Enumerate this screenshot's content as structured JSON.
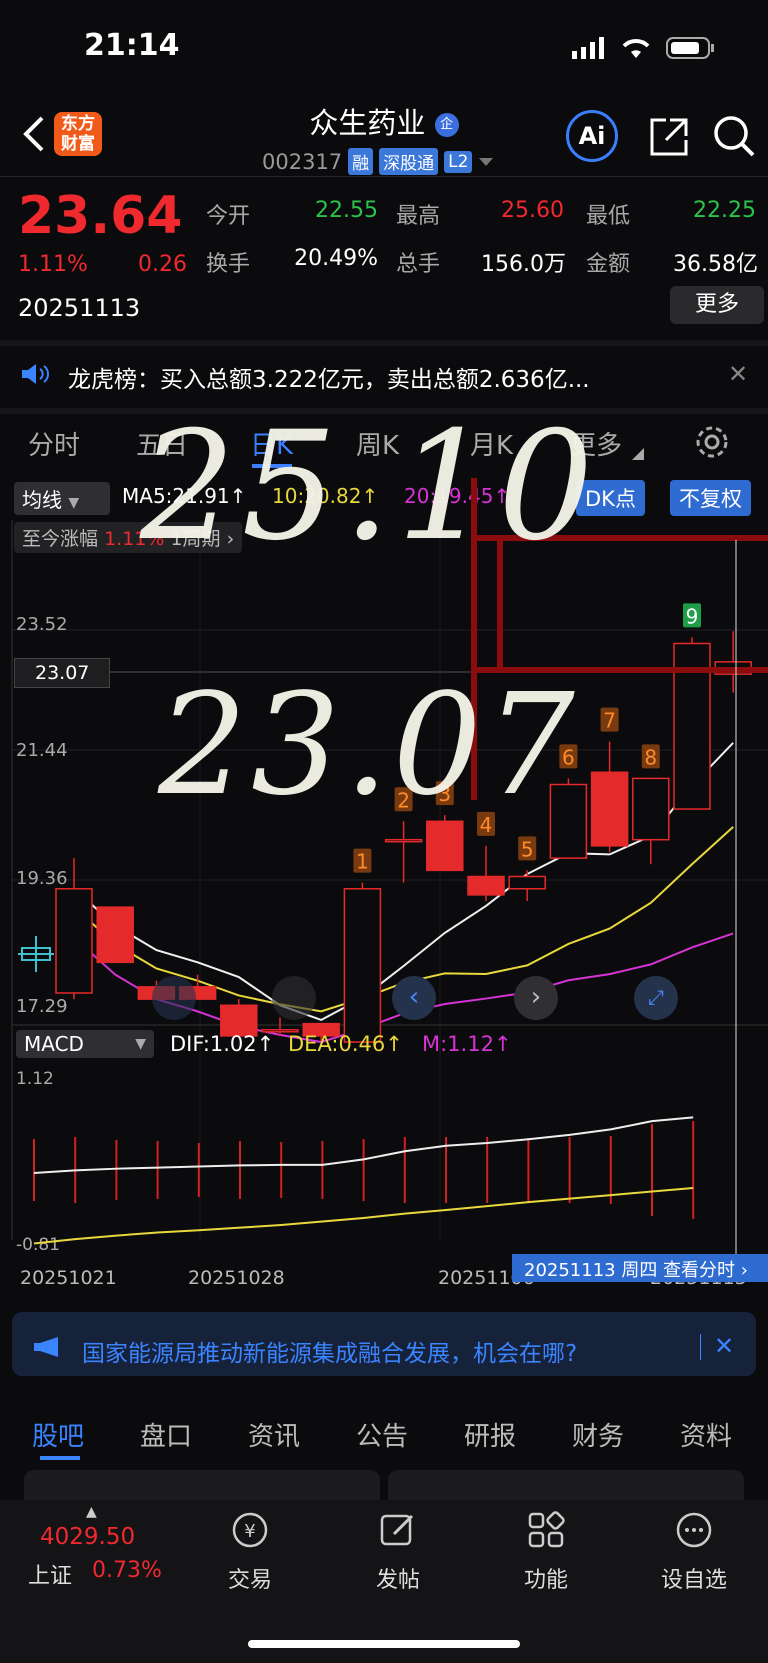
{
  "status": {
    "time": "21:14"
  },
  "header": {
    "logo_line1": "东方",
    "logo_line2": "财富",
    "stock_name": "众生药业",
    "stock_code": "002317",
    "tags": [
      "融",
      "深股通",
      "L2"
    ],
    "badge": "企",
    "ai_label": "Ai"
  },
  "quote": {
    "price": "23.64",
    "change_pct": "1.11%",
    "change": "0.26",
    "date": "20251113",
    "open_label": "今开",
    "open": "22.55",
    "high_label": "最高",
    "high": "25.60",
    "low_label": "最低",
    "low": "22.25",
    "turnover_label": "换手",
    "turnover": "20.49%",
    "volume_label": "总手",
    "volume": "156.0万",
    "amount_label": "金额",
    "amount": "36.58亿",
    "more_label": "更多"
  },
  "dragon_tiger": {
    "text": "龙虎榜：买入总额3.222亿元，卖出总额2.636亿..."
  },
  "chart_tabs": [
    "分时",
    "五日",
    "日K",
    "周K",
    "月K",
    "更多"
  ],
  "chart_controls": {
    "ma_select": "均线",
    "ma5": "MA5:21.91↑",
    "ma10": "10:20.82↑",
    "ma20": "20:19.45↑",
    "dk_button": "DK点",
    "adjust_button": "不复权",
    "range_label": "至今涨幅",
    "range_value": "1.11%",
    "range_period": "1周期",
    "macd_select": "MACD",
    "dif": "DIF:1.02↑",
    "dea": "DEA:0.46↑",
    "m": "M:1.12↑",
    "crosshair_label": "20251113 周四 查看分时"
  },
  "handwriting": {
    "line1": "25.10",
    "line2": "23.07"
  },
  "chart_data": {
    "type": "candlestick",
    "y_ticks": [
      "23.52",
      "21.44",
      "19.36",
      "17.29"
    ],
    "y_range": [
      17.29,
      23.52
    ],
    "ref_price": "23.07",
    "x_labels": [
      "20251021",
      "20251028",
      "20251106",
      "20251113"
    ],
    "candles": [
      {
        "o": 17.6,
        "c": 19.3,
        "h": 19.8,
        "l": 17.5
      },
      {
        "o": 19.0,
        "c": 18.1,
        "h": 19.0,
        "l": 18.1
      },
      {
        "o": 17.7,
        "c": 17.5,
        "h": 17.8,
        "l": 17.5
      },
      {
        "o": 17.7,
        "c": 17.5,
        "h": 17.9,
        "l": 17.5
      },
      {
        "o": 17.4,
        "c": 16.9,
        "h": 17.5,
        "l": 16.9
      },
      {
        "o": 17.0,
        "c": 17.0,
        "h": 17.2,
        "l": 16.9
      },
      {
        "o": 17.1,
        "c": 16.9,
        "h": 17.1,
        "l": 16.8
      },
      {
        "o": 16.8,
        "c": 19.3,
        "h": 19.4,
        "l": 16.8
      },
      {
        "o": 20.1,
        "c": 20.1,
        "h": 20.4,
        "l": 19.4
      },
      {
        "o": 20.4,
        "c": 19.6,
        "h": 20.5,
        "l": 19.6
      },
      {
        "o": 19.5,
        "c": 19.2,
        "h": 20.0,
        "l": 19.1
      },
      {
        "o": 19.3,
        "c": 19.5,
        "h": 19.6,
        "l": 19.1
      },
      {
        "o": 19.8,
        "c": 21.0,
        "h": 21.1,
        "l": 19.8
      },
      {
        "o": 21.2,
        "c": 20.0,
        "h": 21.7,
        "l": 19.9
      },
      {
        "o": 20.1,
        "c": 21.1,
        "h": 21.1,
        "l": 19.7
      },
      {
        "o": 20.6,
        "c": 23.3,
        "h": 23.4,
        "l": 20.6
      },
      {
        "o": 22.8,
        "c": 23.0,
        "h": 23.5,
        "l": 22.5
      }
    ],
    "markers": [
      "1",
      "2",
      "3",
      "4",
      "5",
      "6",
      "7",
      "8",
      "9"
    ],
    "macd_ticks": [
      "1.12",
      "-0.81"
    ]
  },
  "promo": {
    "text": "国家能源局推动新能源集成融合发展，机会在哪?"
  },
  "bottom_tabs": [
    "股吧",
    "盘口",
    "资讯",
    "公告",
    "研报",
    "财务",
    "资料"
  ],
  "bottom_nav": {
    "index_value": "4029.50",
    "index_name": "上证",
    "index_pct": "0.73%",
    "trade": "交易",
    "post": "发帖",
    "function": "功能",
    "watchlist": "设自选"
  }
}
